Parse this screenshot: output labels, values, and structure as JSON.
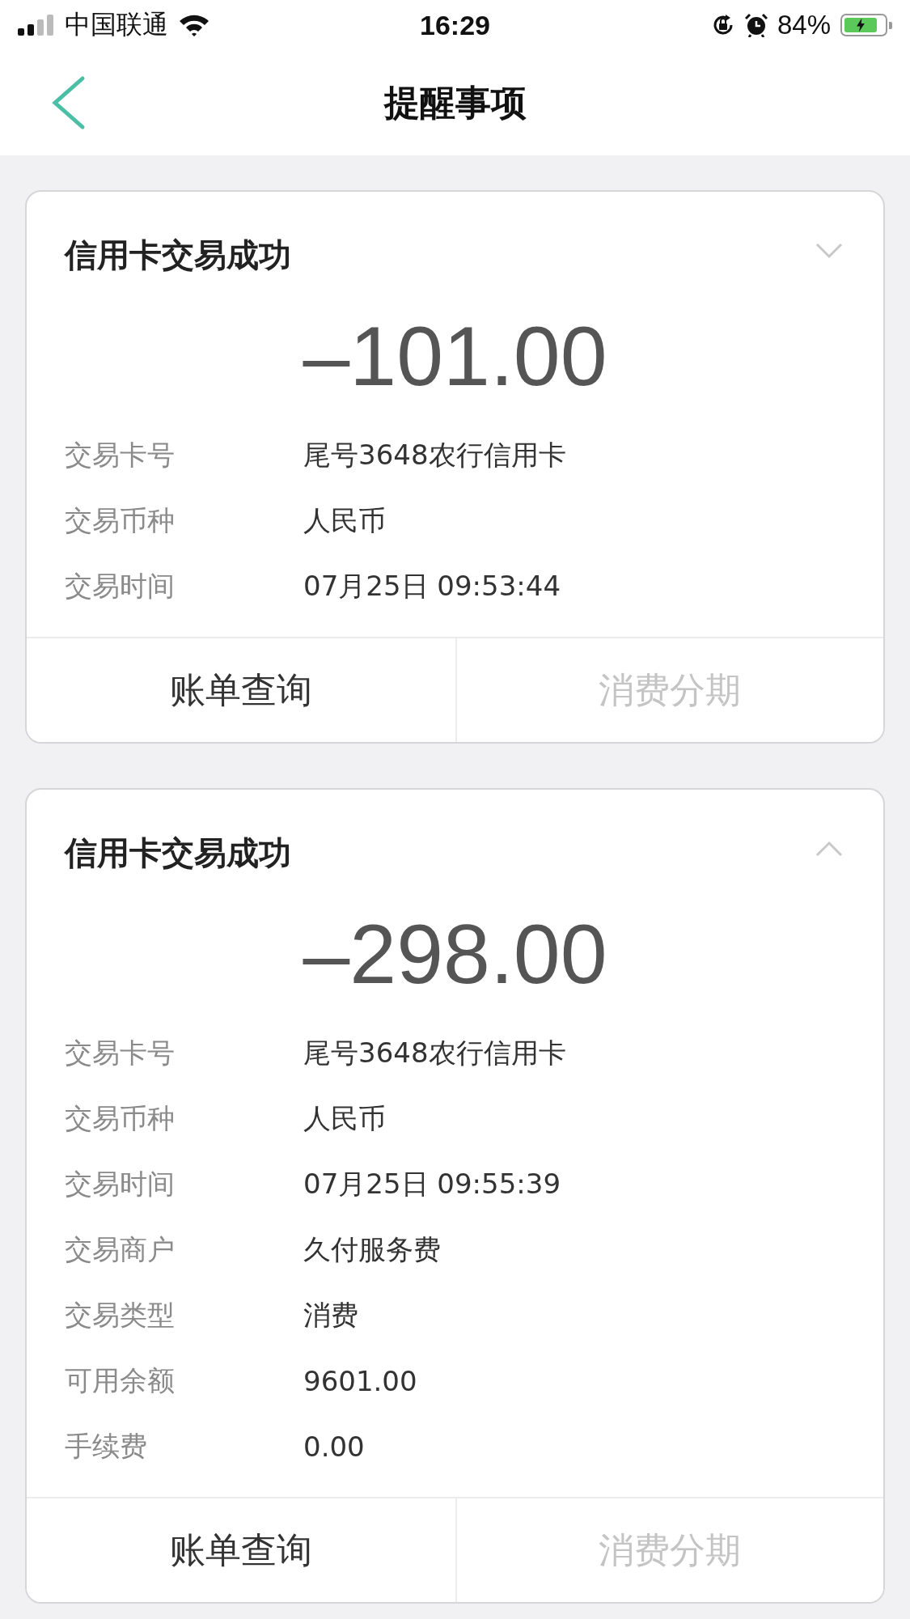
{
  "status_bar": {
    "carrier": "中国联通",
    "time": "16:29",
    "battery_text": "84%",
    "battery": {
      "level": 0.84,
      "charging": true
    }
  },
  "nav": {
    "title": "提醒事项"
  },
  "cards": [
    {
      "title": "信用卡交易成功",
      "expanded": false,
      "amount": "–101.00",
      "rows": [
        {
          "label": "交易卡号",
          "value": "尾号3648农行信用卡"
        },
        {
          "label": "交易币种",
          "value": "人民币"
        },
        {
          "label": "交易时间",
          "value": "07月25日 09:53:44"
        }
      ],
      "buttons": [
        {
          "label": "账单查询",
          "disabled": false
        },
        {
          "label": "消费分期",
          "disabled": true
        }
      ]
    },
    {
      "title": "信用卡交易成功",
      "expanded": true,
      "amount": "–298.00",
      "rows": [
        {
          "label": "交易卡号",
          "value": "尾号3648农行信用卡"
        },
        {
          "label": "交易币种",
          "value": "人民币"
        },
        {
          "label": "交易时间",
          "value": "07月25日 09:55:39"
        },
        {
          "label": "交易商户",
          "value": "久付服务费"
        },
        {
          "label": "交易类型",
          "value": "消费"
        },
        {
          "label": "可用余额",
          "value": "9601.00"
        },
        {
          "label": "手续费",
          "value": "0.00"
        }
      ],
      "buttons": [
        {
          "label": "账单查询",
          "disabled": false
        },
        {
          "label": "消费分期",
          "disabled": true
        }
      ]
    }
  ]
}
